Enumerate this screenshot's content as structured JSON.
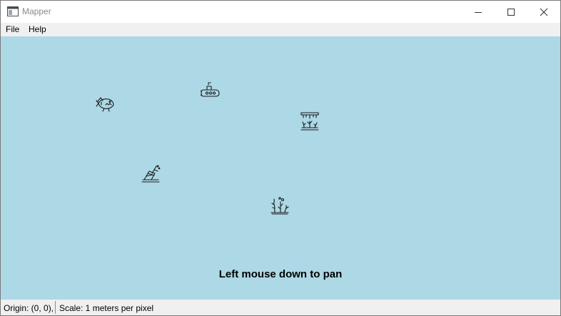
{
  "window": {
    "title": "Mapper",
    "controls": {
      "minimize_icon": "minimize-icon",
      "maximize_icon": "maximize-icon",
      "close_icon": "close-icon"
    }
  },
  "menu": {
    "items": [
      {
        "label": "File"
      },
      {
        "label": "Help"
      }
    ]
  },
  "map": {
    "background_color": "#add8e6",
    "markers": [
      {
        "icon": "shark-icon"
      },
      {
        "icon": "submarine-icon"
      },
      {
        "icon": "coral-reef-icon"
      },
      {
        "icon": "shipwreck-icon"
      },
      {
        "icon": "seaweed-icon"
      }
    ],
    "hint": "Left mouse down to pan"
  },
  "status": {
    "origin": "Origin: (0, 0),",
    "scale": "Scale: 1 meters per pixel"
  }
}
